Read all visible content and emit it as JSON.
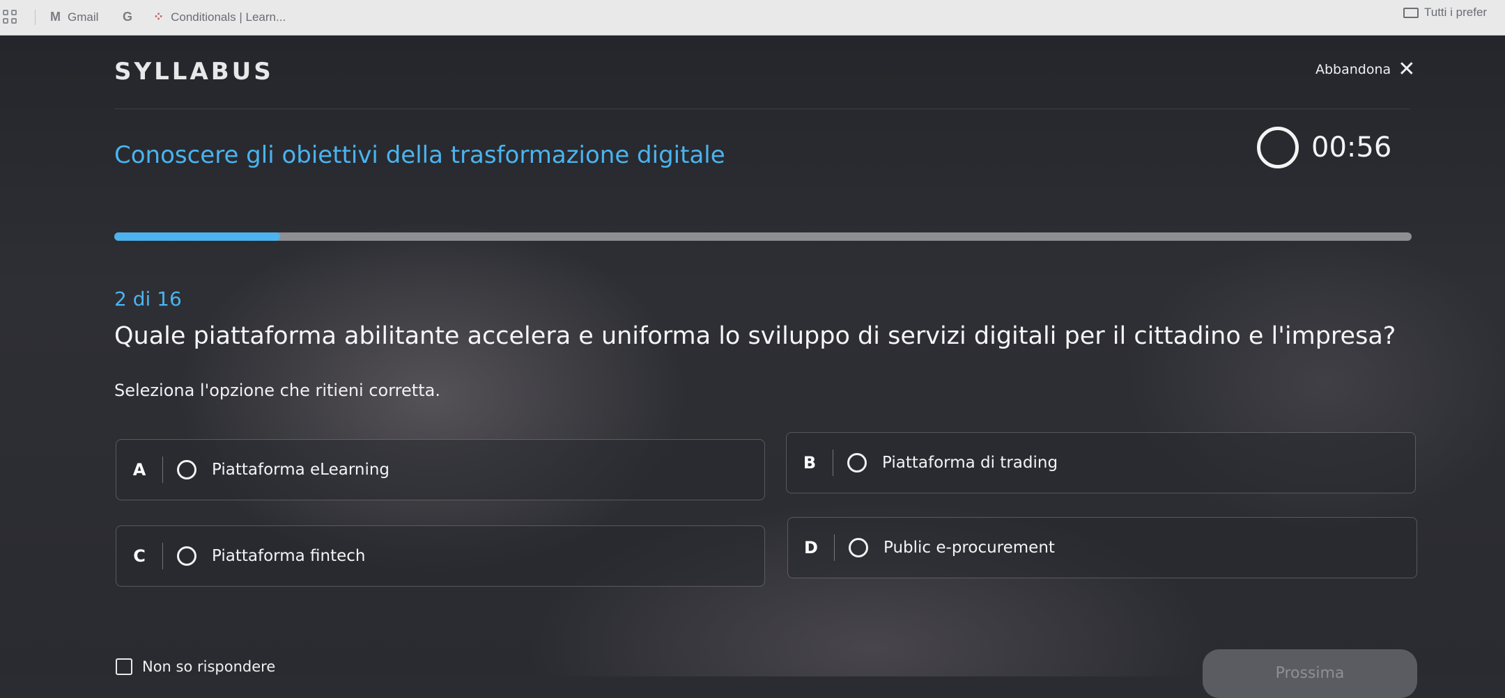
{
  "bookmarks": {
    "gmail": "Gmail",
    "google": "G",
    "conditionals": "Conditionals | Learn...",
    "folder": "Tutti i prefer"
  },
  "header": {
    "logo": "SYLLABUS",
    "abandon_label": "Abbandona",
    "close_glyph": "✕"
  },
  "quiz": {
    "course_title": "Conoscere gli obiettivi della trasformazione digitale",
    "timer": "00:56",
    "progress_fraction": 0.128,
    "counter": "2 di 16",
    "question": "Quale piattaforma abilitante accelera e uniforma lo sviluppo di servizi digitali per il cittadino e l'impresa?",
    "instruction": "Seleziona l'opzione che ritieni corretta.",
    "options": [
      {
        "letter": "A",
        "label": "Piattaforma eLearning"
      },
      {
        "letter": "B",
        "label": "Piattaforma di trading"
      },
      {
        "letter": "C",
        "label": "Piattaforma fintech"
      },
      {
        "letter": "D",
        "label": "Public e-procurement"
      }
    ],
    "dont_know": "Non so rispondere",
    "next_label": "Prossima"
  },
  "colors": {
    "accent": "#4ab4f0",
    "text": "#f4f4f6"
  }
}
